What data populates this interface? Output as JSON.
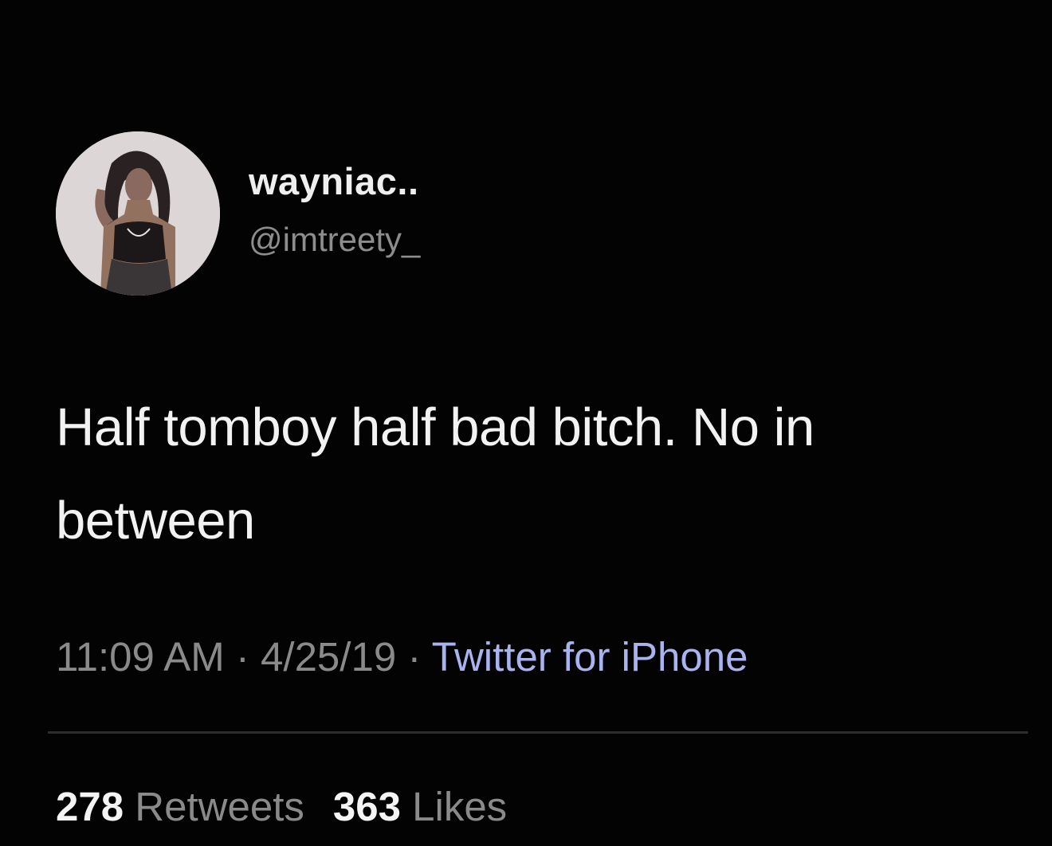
{
  "tweet": {
    "author": {
      "display_name": "wayniac..",
      "handle": "@imtreety_",
      "avatar": "profile-photo"
    },
    "text": "Half tomboy half bad bitch. No in between",
    "meta": {
      "time": "11:09 AM",
      "separator": "·",
      "date": "4/25/19",
      "source": "Twitter for iPhone"
    },
    "stats": {
      "retweets_count": "278",
      "retweets_label": "Retweets",
      "likes_count": "363",
      "likes_label": "Likes"
    }
  },
  "colors": {
    "background": "#030303",
    "primary_text": "#f2f2f2",
    "secondary_text": "#8a8a8a",
    "source_link": "#a9b3ef",
    "divider": "#2c2c2c"
  }
}
